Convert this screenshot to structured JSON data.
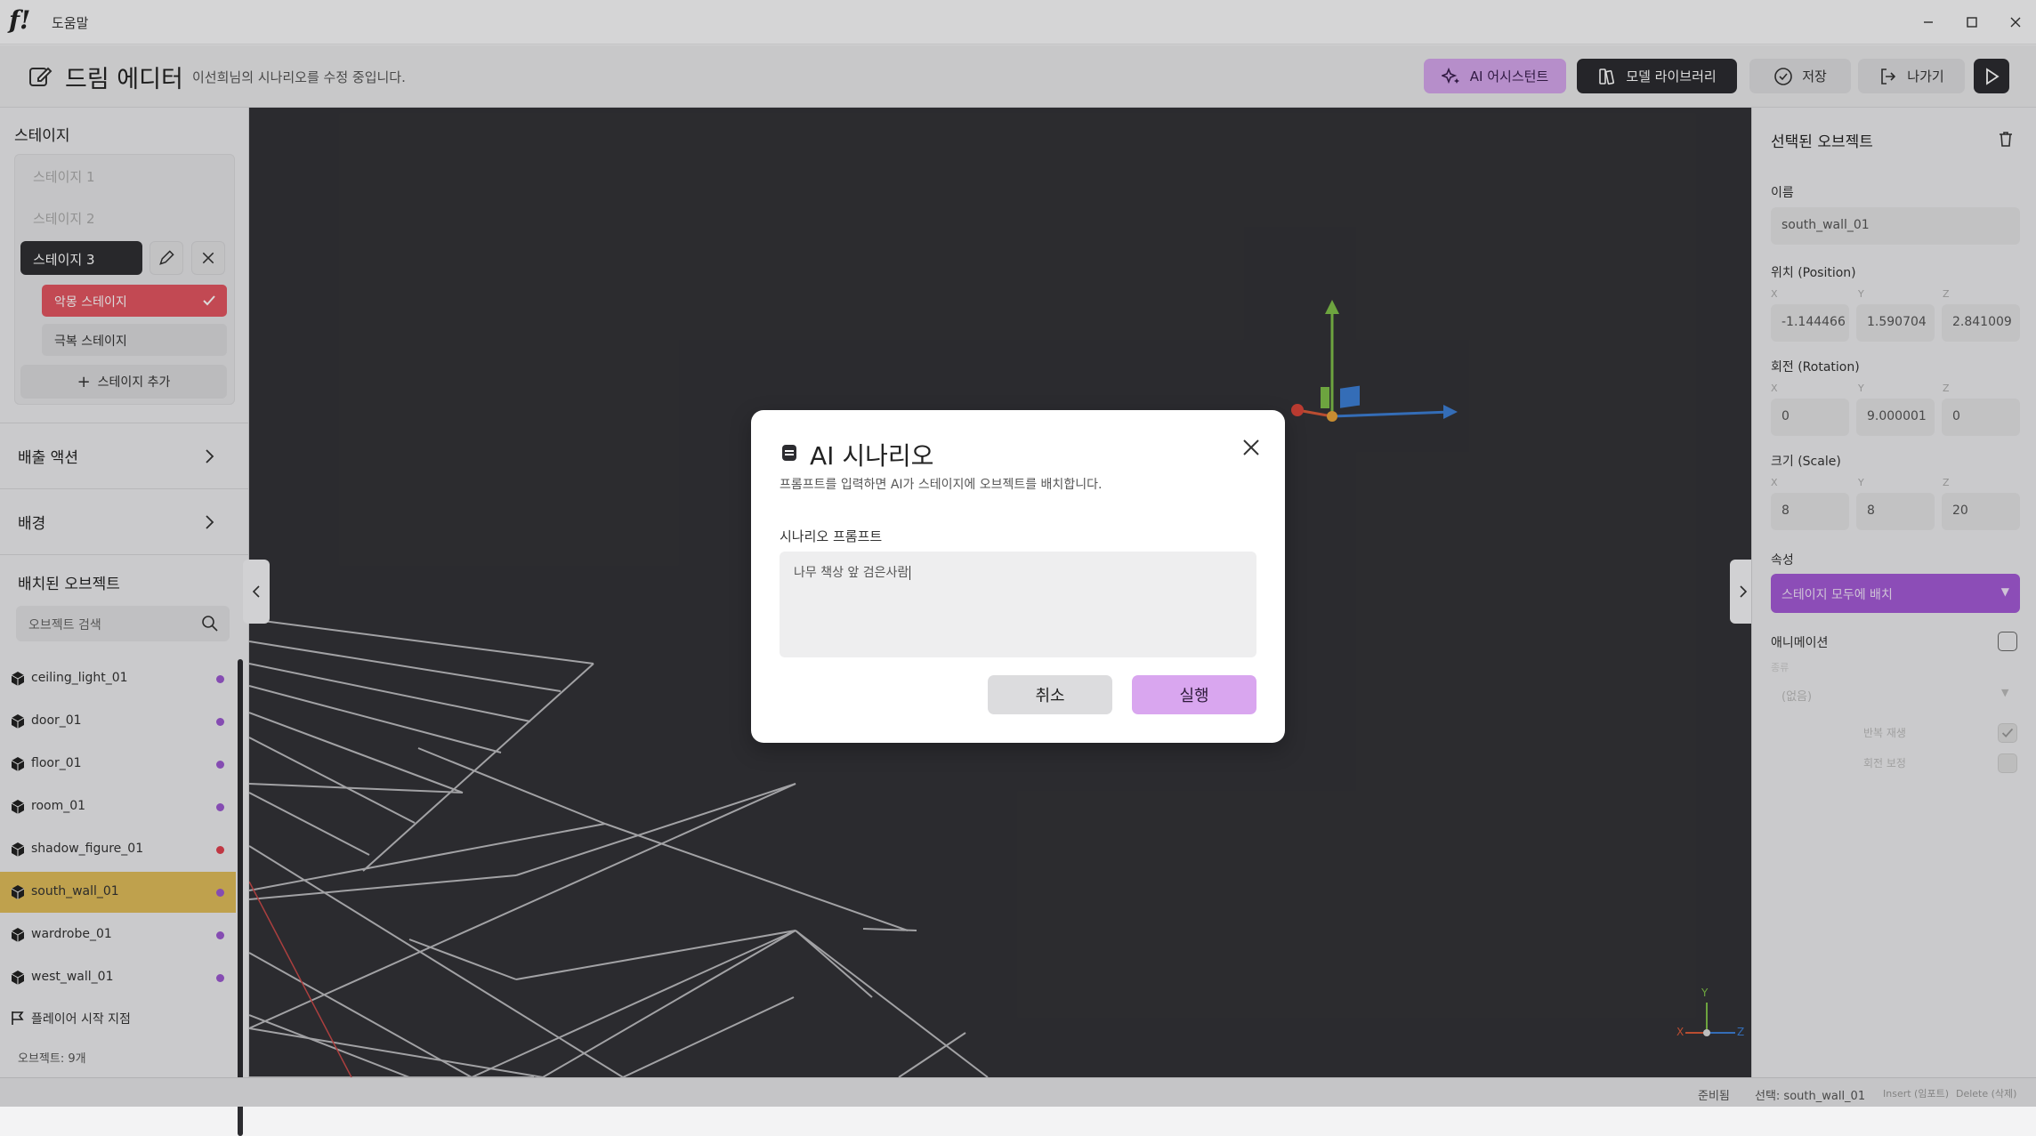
{
  "titlebar": {
    "logo": "f!",
    "title": "도움말"
  },
  "header": {
    "title": "드림 에디터",
    "subtitle": "이선희님의 시나리오를 수정 중입니다.",
    "buttons": {
      "ai": "AI 어시스턴트",
      "model": "모델 라이브러리",
      "save": "저장",
      "exit": "나가기"
    }
  },
  "sidebar": {
    "stage_title": "스테이지",
    "stages": [
      "스테이지 1",
      "스테이지 2"
    ],
    "selected_stage": "스테이지 3",
    "sub_stages": [
      "악몽 스테이지",
      "극복 스테이지"
    ],
    "add_stage": "스테이지 추가",
    "sections": [
      "배출 액션",
      "배경"
    ],
    "objects_title": "배치된 오브젝트",
    "search_placeholder": "오브젝트 검색",
    "objects": [
      {
        "name": "ceiling_light_01",
        "color": "#9b59d0"
      },
      {
        "name": "door_01",
        "color": "#9b59d0"
      },
      {
        "name": "floor_01",
        "color": "#9b59d0"
      },
      {
        "name": "room_01",
        "color": "#9b59d0"
      },
      {
        "name": "shadow_figure_01",
        "color": "#e0414f"
      },
      {
        "name": "south_wall_01",
        "color": "#9b59d0"
      },
      {
        "name": "wardrobe_01",
        "color": "#9b59d0"
      },
      {
        "name": "west_wall_01",
        "color": "#9b59d0"
      }
    ],
    "player_start": "플레이어 시작 지점",
    "count": "오브젝트: 9개"
  },
  "right_panel": {
    "title": "선택된 오브젝트",
    "name_label": "이름",
    "name_value": "south_wall_01",
    "position_label": "위치 (Position)",
    "position": [
      "-1.144466",
      "1.590704",
      "2.841009"
    ],
    "rotation_label": "회전 (Rotation)",
    "rotation": [
      "0",
      "9.000001",
      "0"
    ],
    "scale_label": "크기 (Scale)",
    "scale": [
      "8",
      "8",
      "20"
    ],
    "axes": [
      "X",
      "Y",
      "Z"
    ],
    "attr_label": "속성",
    "attr_value": "스테이지 모두에 배치",
    "anim_label": "애니메이션",
    "anim_type_label": "종류",
    "anim_type_value": "(없음)",
    "loop_label": "반복 재생",
    "rotate_label": "회전 보정"
  },
  "viewport": {
    "axis_labels": [
      "Y",
      "X",
      "Z"
    ]
  },
  "status": {
    "ready": "준비됨",
    "selection": "선택: south_wall_01",
    "insert": "Insert (임포트)",
    "delete": "Delete (삭제)"
  },
  "modal": {
    "title": "AI 시나리오",
    "description": "프롬프트를 입력하면 AI가 스테이지에 오브젝트를 배치합니다.",
    "label": "시나리오 프롬프트",
    "value": "나무 책상 앞 검은사람",
    "cancel": "취소",
    "run": "실행"
  }
}
